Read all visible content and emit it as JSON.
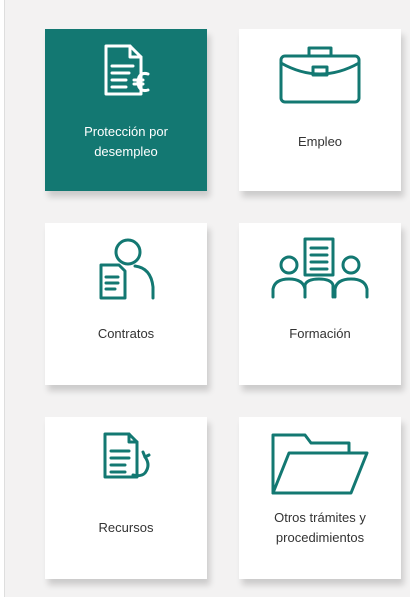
{
  "colors": {
    "accent": "#137872",
    "panel_bg": "#f3f2f2",
    "card_bg": "#ffffff",
    "label_text": "#333333",
    "active_label_text": "#ffffff"
  },
  "cards": [
    {
      "label": "Protección por\ndesempleo",
      "icon": "unemployment-document-euro-icon",
      "active": true
    },
    {
      "label": "Empleo",
      "icon": "briefcase-icon",
      "active": false
    },
    {
      "label": "Contratos",
      "icon": "contract-person-icon",
      "active": false
    },
    {
      "label": "Formación",
      "icon": "training-group-icon",
      "active": false
    },
    {
      "label": "Recursos",
      "icon": "document-return-icon",
      "active": false
    },
    {
      "label": "Otros trámites y\nprocedimientos",
      "icon": "open-folder-icon",
      "active": false
    }
  ]
}
